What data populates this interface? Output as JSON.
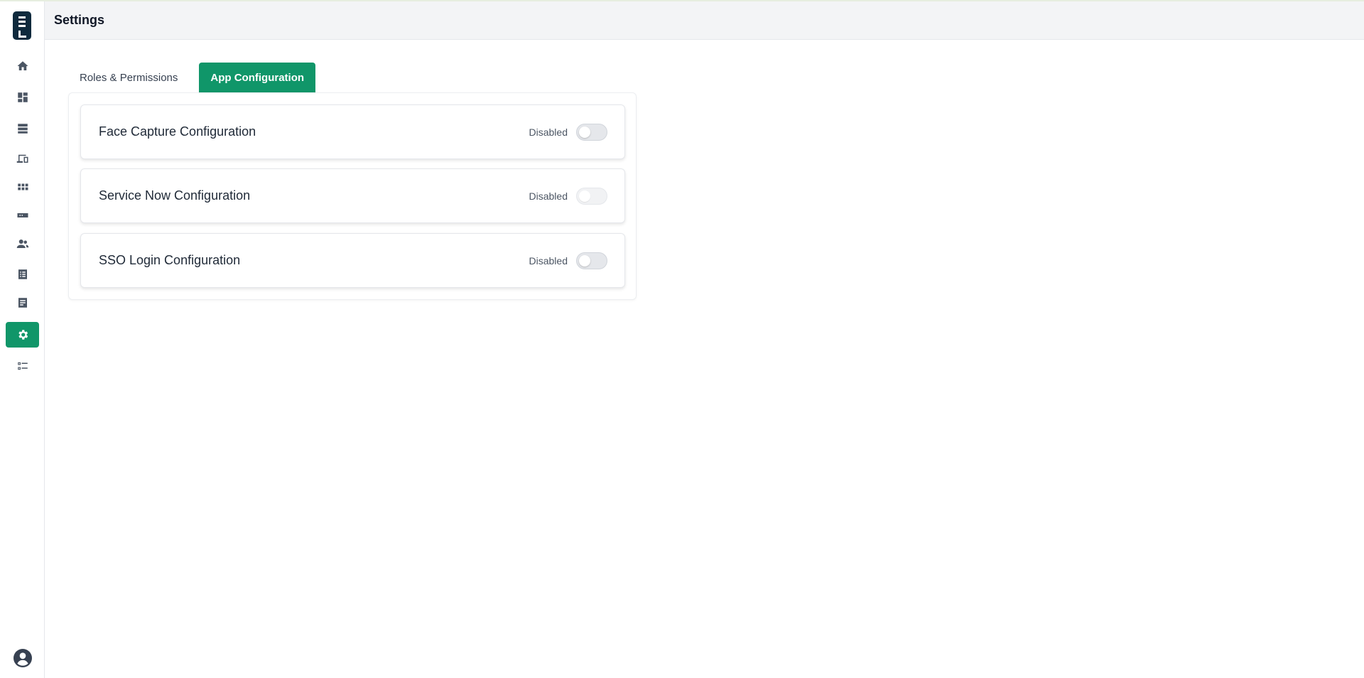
{
  "header": {
    "title": "Settings"
  },
  "sidebar": {
    "items": [
      {
        "name": "home",
        "icon": "home-icon"
      },
      {
        "name": "dashboard",
        "icon": "dashboard-icon"
      },
      {
        "name": "storage",
        "icon": "storage-icon"
      },
      {
        "name": "devices",
        "icon": "devices-icon"
      },
      {
        "name": "apps",
        "icon": "apps-grid-icon"
      },
      {
        "name": "credential",
        "icon": "card-icon"
      },
      {
        "name": "users",
        "icon": "users-icon"
      },
      {
        "name": "list",
        "icon": "list-icon"
      },
      {
        "name": "reports",
        "icon": "document-icon"
      },
      {
        "name": "settings",
        "icon": "gear-icon",
        "active": true
      },
      {
        "name": "checklist",
        "icon": "checklist-icon"
      }
    ],
    "avatar_icon": "user-circle-icon"
  },
  "tabs": [
    {
      "label": "Roles & Permissions",
      "active": false
    },
    {
      "label": "App Configuration",
      "active": true
    }
  ],
  "configs": [
    {
      "title": "Face Capture Configuration",
      "status": "Disabled",
      "enabled": false
    },
    {
      "title": "Service Now Configuration",
      "status": "Disabled",
      "enabled": false
    },
    {
      "title": "SSO Login Configuration",
      "status": "Disabled",
      "enabled": false
    }
  ],
  "colors": {
    "accent": "#109669",
    "logo": "#0f2a3d",
    "header_bg": "#f3f4f6"
  }
}
